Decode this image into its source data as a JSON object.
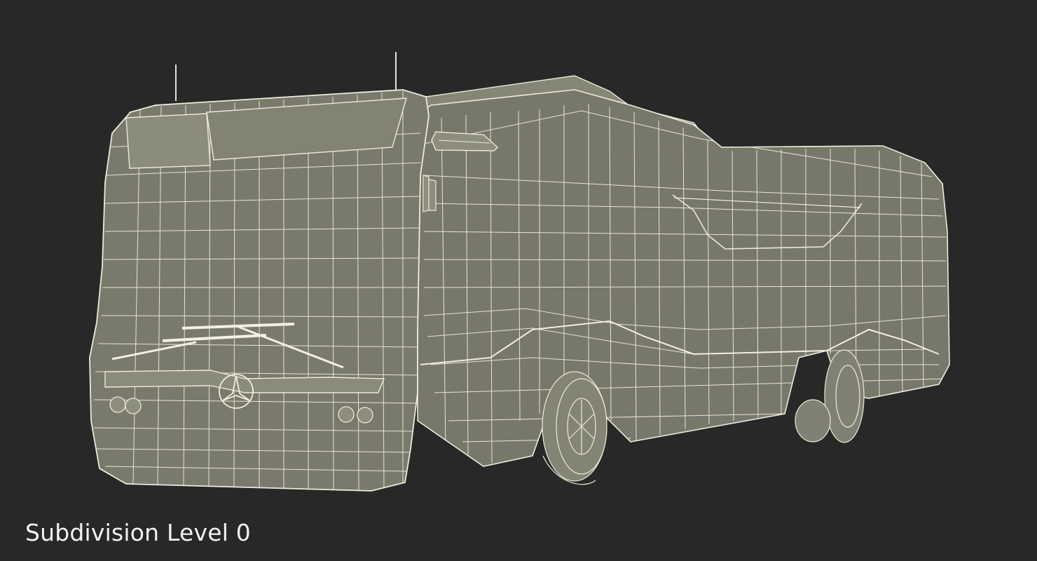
{
  "caption": "Subdivision Level 0",
  "colors": {
    "background": "#282828",
    "surface": "#7a7b6c",
    "surface_shadow": "#66675a",
    "wire": "#eceadb",
    "caption": "#f2f2f2"
  },
  "icons": {
    "front_emblem": "three-pointed-star-icon"
  }
}
